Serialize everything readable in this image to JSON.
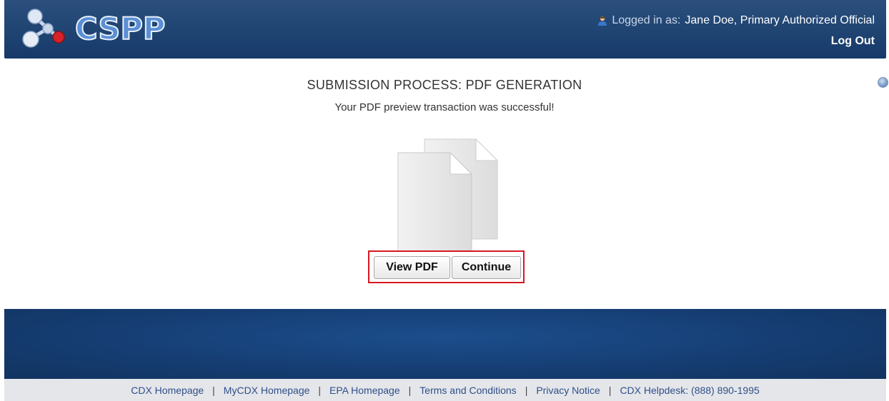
{
  "header": {
    "logo_text": "CSPP",
    "login_prefix": "Logged in as:",
    "user_name": "Jane Doe, Primary Authorized Official",
    "logout_label": "Log Out"
  },
  "main": {
    "title": "SUBMISSION PROCESS: PDF GENERATION",
    "message": "Your PDF preview transaction was successful!",
    "buttons": {
      "view_pdf": "View PDF",
      "continue": "Continue"
    }
  },
  "footer": {
    "links": [
      "CDX Homepage",
      "MyCDX Homepage",
      "EPA Homepage",
      "Terms and Conditions",
      "Privacy Notice",
      "CDX Helpdesk: (888) 890-1995"
    ],
    "separator": "|"
  },
  "icons": {
    "logo": "molecule-logo-icon",
    "user": "user-icon",
    "help": "help-icon",
    "pdf": "pdf-documents-icon"
  },
  "colors": {
    "header_bg": "#1f4472",
    "highlight_border": "#d71920",
    "footer_link": "#2f4f88"
  }
}
